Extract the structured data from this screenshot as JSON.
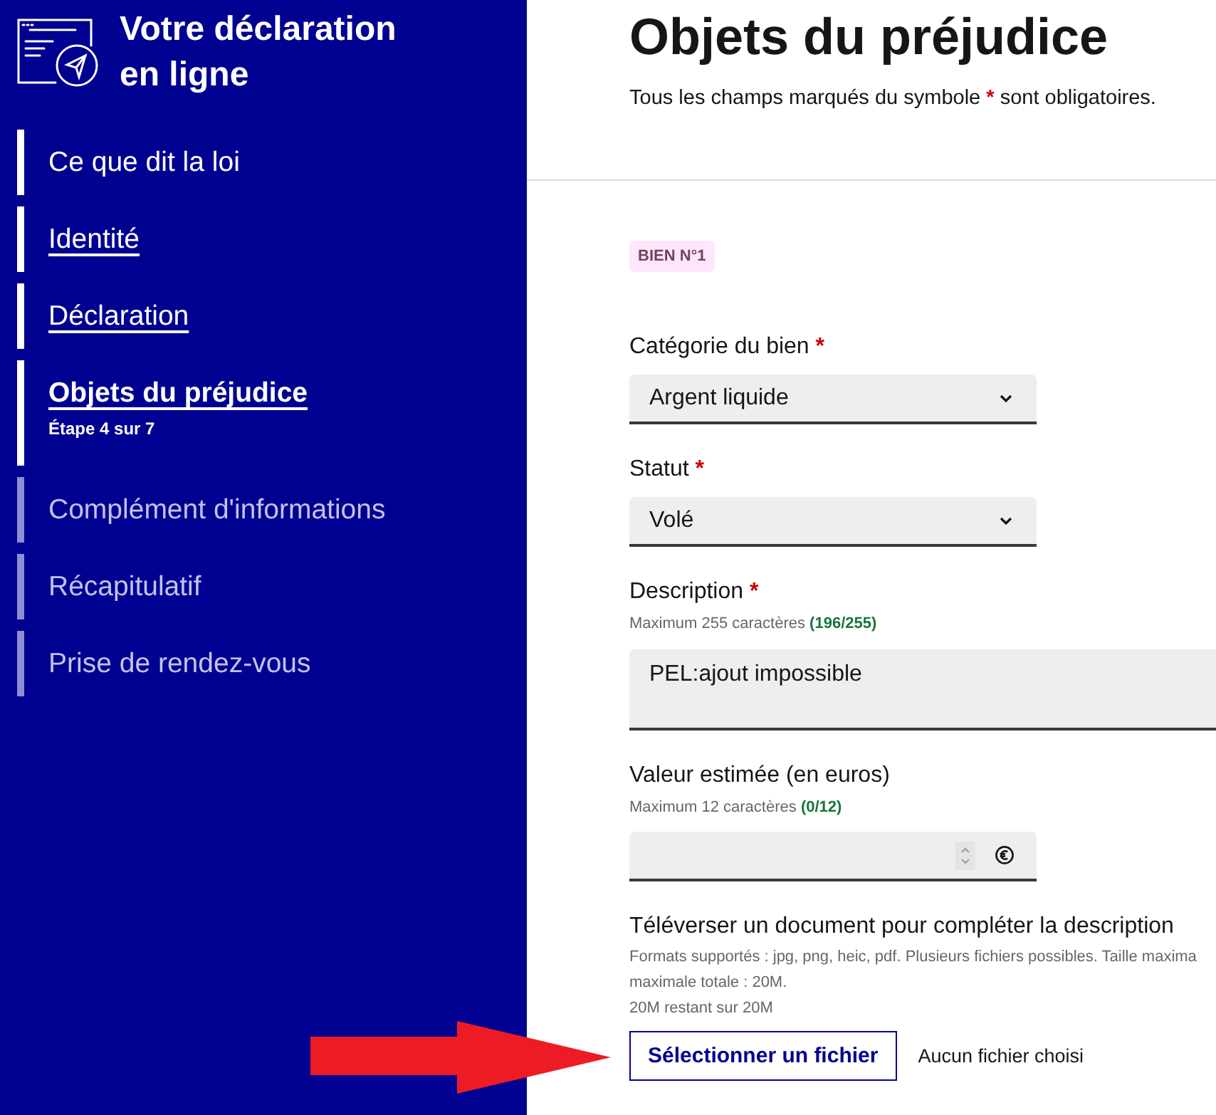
{
  "sidebar": {
    "title": "Votre déclaration en ligne",
    "steps": [
      {
        "label": "Ce que dit la loi",
        "kind": "intro",
        "selected": false,
        "disabled": false
      },
      {
        "label": "Identité",
        "kind": "step",
        "selected": false,
        "disabled": false
      },
      {
        "label": "Déclaration",
        "kind": "step",
        "selected": false,
        "disabled": false
      },
      {
        "label": "Objets du préjudice",
        "kind": "step",
        "selected": true,
        "disabled": false,
        "caption": "Étape 4 sur 7"
      },
      {
        "label": "Complément d'informations",
        "kind": "step",
        "selected": false,
        "disabled": true
      },
      {
        "label": "Récapitulatif",
        "kind": "step",
        "selected": false,
        "disabled": true
      },
      {
        "label": "Prise de rendez-vous",
        "kind": "step",
        "selected": false,
        "disabled": true
      }
    ]
  },
  "page": {
    "heading": "Objets du préjudice",
    "required_note": {
      "before": "Tous les champs marqués du symbole",
      "mark": "*",
      "after": "sont obligatoires."
    }
  },
  "item": {
    "badge": "BIEN N°1",
    "fields": [
      {
        "kind": "select",
        "label": "Catégorie du bien",
        "required_mark": "*",
        "value": "Argent liquide"
      },
      {
        "kind": "select",
        "label": "Statut",
        "required_mark": "*",
        "value": "Volé"
      },
      {
        "kind": "textarea",
        "label": "Description",
        "required_mark": "*",
        "hint": "Maximum 255 caractères **(196/255)**",
        "value": "PEL:ajout impossible"
      },
      {
        "kind": "amount",
        "label": "Valeur estimée (en euros)",
        "hint": "Maximum 12 caractères **(0/12)**"
      },
      {
        "kind": "file",
        "label": "Téléverser un document pour compléter la description",
        "hint_lines": [
          "Formats supportés : jpg, png, heic, pdf. Plusieurs fichiers possibles. Taille maxima",
          "maximale totale : 20M."
        ],
        "quota": "20M restant sur 20M",
        "button": "Sélectionner un fichier",
        "status": "Aucun fichier choisi"
      }
    ]
  }
}
